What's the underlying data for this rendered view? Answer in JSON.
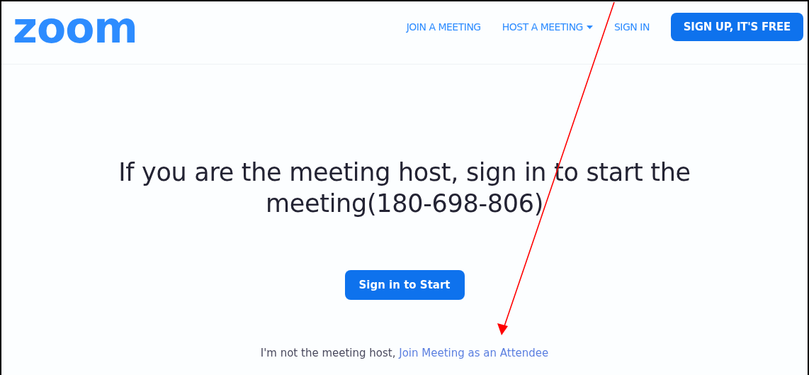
{
  "header": {
    "logo": "zoom",
    "nav": [
      {
        "label": "JOIN A MEETING",
        "kind": "link"
      },
      {
        "label": "HOST A MEETING",
        "kind": "dropdown"
      },
      {
        "label": "SIGN IN",
        "kind": "link"
      },
      {
        "label": "SIGN UP, IT'S FREE",
        "kind": "button"
      }
    ]
  },
  "heading": "If you are the meeting host, sign in to start the meeting(180-698-806)",
  "start_button": "Sign in to Start",
  "attendee_prompt": {
    "text": "I'm not the meeting host,",
    "link": "Join Meeting as an Attendee"
  }
}
